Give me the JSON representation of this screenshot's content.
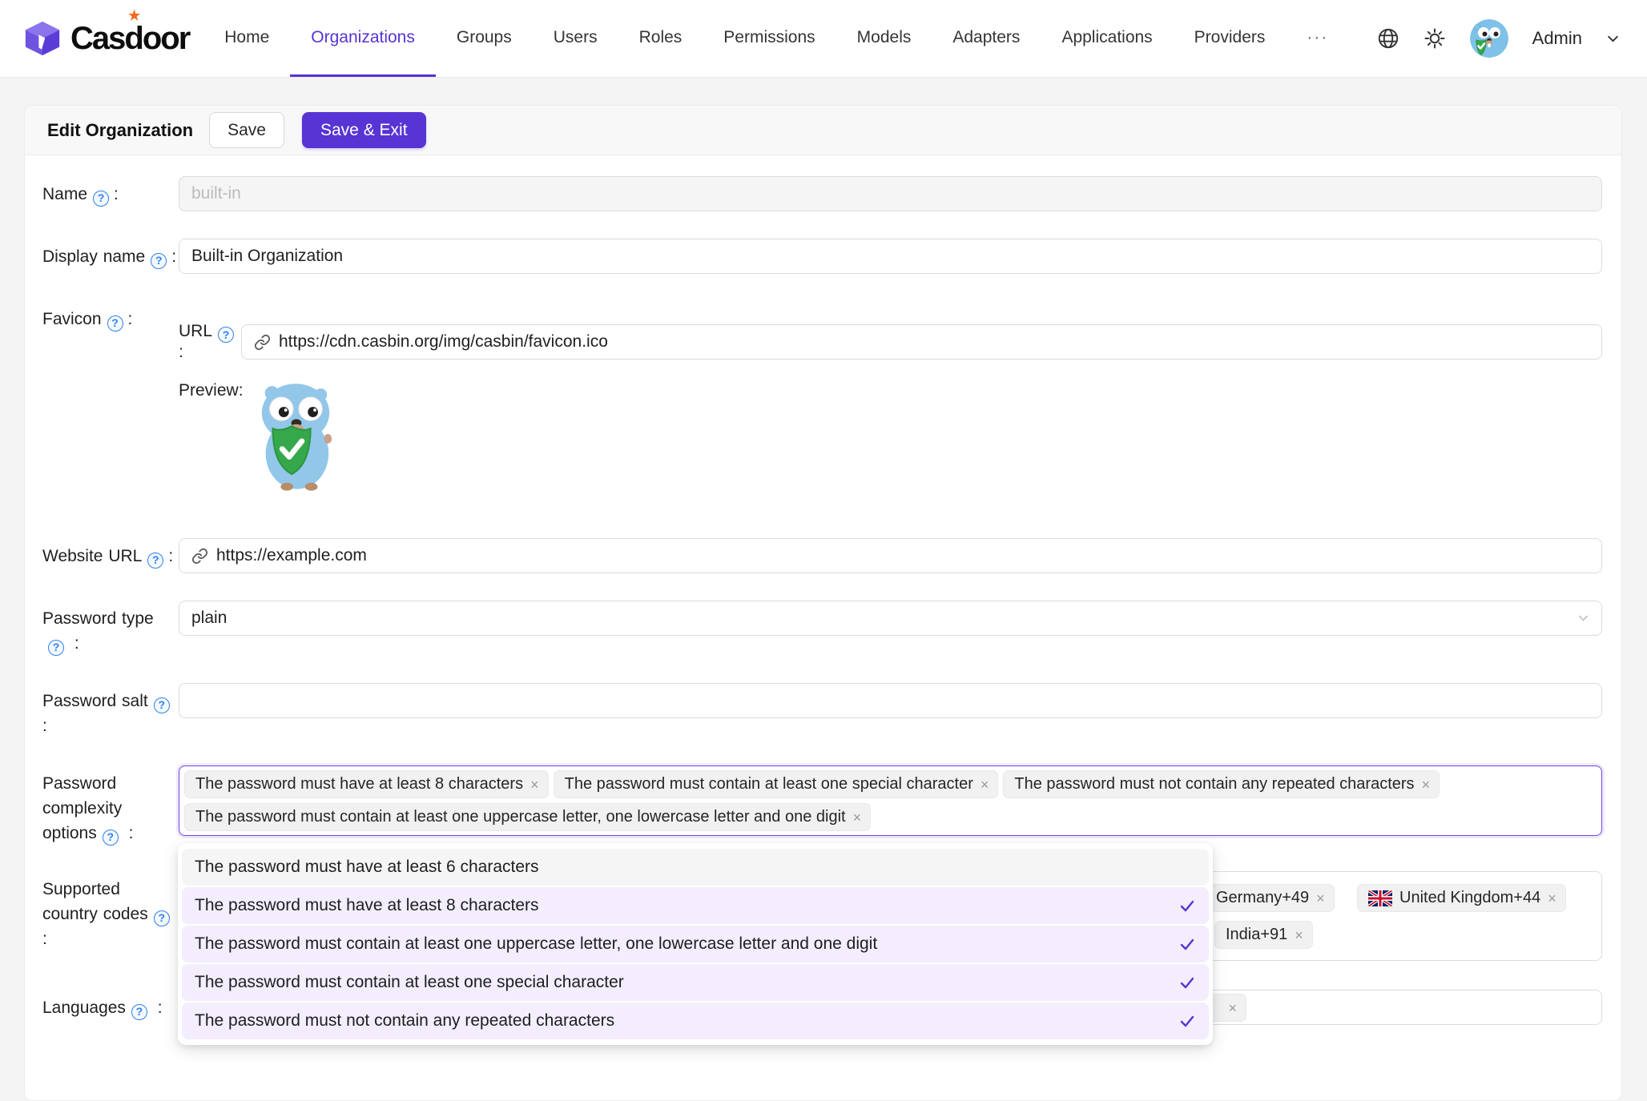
{
  "colors": {
    "accent": "#5734d3",
    "help_blue": "#2f80ed"
  },
  "navbar": {
    "brand": "Casdoor",
    "items": [
      {
        "label": "Home"
      },
      {
        "label": "Organizations"
      },
      {
        "label": "Groups"
      },
      {
        "label": "Users"
      },
      {
        "label": "Roles"
      },
      {
        "label": "Permissions"
      },
      {
        "label": "Models"
      },
      {
        "label": "Adapters"
      },
      {
        "label": "Applications"
      },
      {
        "label": "Providers"
      },
      {
        "label": "···"
      }
    ],
    "active_item": "Organizations",
    "user": "Admin"
  },
  "header": {
    "title": "Edit Organization",
    "save": "Save",
    "save_exit": "Save & Exit"
  },
  "form": {
    "colon": ":",
    "name": {
      "label": "Name",
      "placeholder": "built-in"
    },
    "display_name": {
      "label": "Display name",
      "value": "Built-in Organization"
    },
    "favicon": {
      "label": "Favicon",
      "url_label": "URL",
      "url": "https://cdn.casbin.org/img/casbin/favicon.ico",
      "preview_label": "Preview:"
    },
    "website_url": {
      "label": "Website URL",
      "value": "https://example.com"
    },
    "password_type": {
      "label": "Password type",
      "value": "plain"
    },
    "password_salt": {
      "label": "Password salt",
      "value": ""
    },
    "password_complexity": {
      "label": "Password complexity options",
      "tags": [
        "The password must have at least 8 characters",
        "The password must contain at least one special character",
        "The password must not contain any repeated characters",
        "The password must contain at least one uppercase letter, one lowercase letter and one digit"
      ]
    },
    "country_codes": {
      "label": "Supported country codes",
      "tags": [
        {
          "label": "Germany+49",
          "flag": ""
        },
        {
          "label": "United Kingdom+44",
          "flag": "uk-flag"
        },
        {
          "label": "India+91",
          "flag": ""
        }
      ]
    },
    "languages": {
      "label": "Languages"
    }
  },
  "dropdown": {
    "options": [
      {
        "label": "The password must have at least 6 characters",
        "selected": false
      },
      {
        "label": "The password must have at least 8 characters",
        "selected": true
      },
      {
        "label": "The password must contain at least one uppercase letter, one lowercase letter and one digit",
        "selected": true
      },
      {
        "label": "The password must contain at least one special character",
        "selected": true
      },
      {
        "label": "The password must not contain any repeated characters",
        "selected": true
      }
    ]
  }
}
